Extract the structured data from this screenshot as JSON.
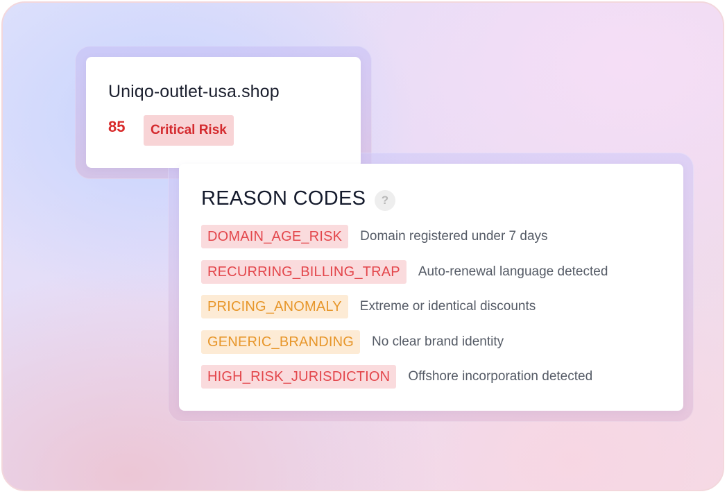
{
  "domain_card": {
    "domain": "Uniqo-outlet-usa.shop",
    "score": "85",
    "risk_label": "Critical Risk"
  },
  "reasons_card": {
    "title": "REASON CODES",
    "help_icon": "?",
    "codes": [
      {
        "code": "DOMAIN_AGE_RISK",
        "description": "Domain registered under 7 days",
        "severity": "high"
      },
      {
        "code": "RECURRING_BILLING_TRAP",
        "description": "Auto-renewal language detected",
        "severity": "high"
      },
      {
        "code": "PRICING_ANOMALY",
        "description": "Extreme or identical discounts",
        "severity": "medium"
      },
      {
        "code": "GENERIC_BRANDING",
        "description": "No clear brand identity",
        "severity": "medium"
      },
      {
        "code": "HIGH_RISK_JURISDICTION",
        "description": "Offshore incorporation detected",
        "severity": "high"
      }
    ]
  },
  "colors": {
    "high_text": "#e3464b",
    "high_bg": "#fadbdd",
    "medium_text": "#e7962a",
    "medium_bg": "#fdebd5",
    "critical_text": "#d42a2e",
    "critical_bg": "#f8d4d6"
  }
}
